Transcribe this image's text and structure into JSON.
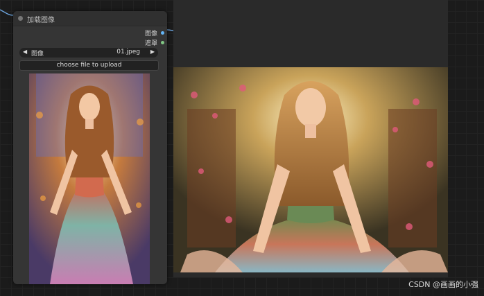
{
  "node": {
    "title": "加载图像",
    "outputs": [
      {
        "label": "图像",
        "color": "#64b5f6"
      },
      {
        "label": "遮罩",
        "color": "#81c784"
      }
    ],
    "image_widget": {
      "label": "图像",
      "value": "01.jpeg"
    },
    "upload_button": "choose file to upload"
  },
  "watermark": "CSDN @画画的小强"
}
